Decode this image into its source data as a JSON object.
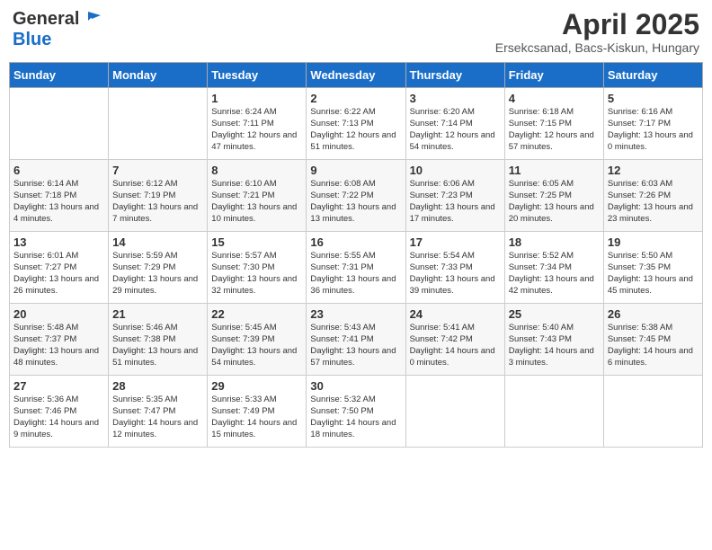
{
  "header": {
    "logo_general": "General",
    "logo_blue": "Blue",
    "title": "April 2025",
    "subtitle": "Ersekcsanad, Bacs-Kiskun, Hungary"
  },
  "days_of_week": [
    "Sunday",
    "Monday",
    "Tuesday",
    "Wednesday",
    "Thursday",
    "Friday",
    "Saturday"
  ],
  "weeks": [
    [
      {
        "day": "",
        "info": ""
      },
      {
        "day": "",
        "info": ""
      },
      {
        "day": "1",
        "info": "Sunrise: 6:24 AM\nSunset: 7:11 PM\nDaylight: 12 hours and 47 minutes."
      },
      {
        "day": "2",
        "info": "Sunrise: 6:22 AM\nSunset: 7:13 PM\nDaylight: 12 hours and 51 minutes."
      },
      {
        "day": "3",
        "info": "Sunrise: 6:20 AM\nSunset: 7:14 PM\nDaylight: 12 hours and 54 minutes."
      },
      {
        "day": "4",
        "info": "Sunrise: 6:18 AM\nSunset: 7:15 PM\nDaylight: 12 hours and 57 minutes."
      },
      {
        "day": "5",
        "info": "Sunrise: 6:16 AM\nSunset: 7:17 PM\nDaylight: 13 hours and 0 minutes."
      }
    ],
    [
      {
        "day": "6",
        "info": "Sunrise: 6:14 AM\nSunset: 7:18 PM\nDaylight: 13 hours and 4 minutes."
      },
      {
        "day": "7",
        "info": "Sunrise: 6:12 AM\nSunset: 7:19 PM\nDaylight: 13 hours and 7 minutes."
      },
      {
        "day": "8",
        "info": "Sunrise: 6:10 AM\nSunset: 7:21 PM\nDaylight: 13 hours and 10 minutes."
      },
      {
        "day": "9",
        "info": "Sunrise: 6:08 AM\nSunset: 7:22 PM\nDaylight: 13 hours and 13 minutes."
      },
      {
        "day": "10",
        "info": "Sunrise: 6:06 AM\nSunset: 7:23 PM\nDaylight: 13 hours and 17 minutes."
      },
      {
        "day": "11",
        "info": "Sunrise: 6:05 AM\nSunset: 7:25 PM\nDaylight: 13 hours and 20 minutes."
      },
      {
        "day": "12",
        "info": "Sunrise: 6:03 AM\nSunset: 7:26 PM\nDaylight: 13 hours and 23 minutes."
      }
    ],
    [
      {
        "day": "13",
        "info": "Sunrise: 6:01 AM\nSunset: 7:27 PM\nDaylight: 13 hours and 26 minutes."
      },
      {
        "day": "14",
        "info": "Sunrise: 5:59 AM\nSunset: 7:29 PM\nDaylight: 13 hours and 29 minutes."
      },
      {
        "day": "15",
        "info": "Sunrise: 5:57 AM\nSunset: 7:30 PM\nDaylight: 13 hours and 32 minutes."
      },
      {
        "day": "16",
        "info": "Sunrise: 5:55 AM\nSunset: 7:31 PM\nDaylight: 13 hours and 36 minutes."
      },
      {
        "day": "17",
        "info": "Sunrise: 5:54 AM\nSunset: 7:33 PM\nDaylight: 13 hours and 39 minutes."
      },
      {
        "day": "18",
        "info": "Sunrise: 5:52 AM\nSunset: 7:34 PM\nDaylight: 13 hours and 42 minutes."
      },
      {
        "day": "19",
        "info": "Sunrise: 5:50 AM\nSunset: 7:35 PM\nDaylight: 13 hours and 45 minutes."
      }
    ],
    [
      {
        "day": "20",
        "info": "Sunrise: 5:48 AM\nSunset: 7:37 PM\nDaylight: 13 hours and 48 minutes."
      },
      {
        "day": "21",
        "info": "Sunrise: 5:46 AM\nSunset: 7:38 PM\nDaylight: 13 hours and 51 minutes."
      },
      {
        "day": "22",
        "info": "Sunrise: 5:45 AM\nSunset: 7:39 PM\nDaylight: 13 hours and 54 minutes."
      },
      {
        "day": "23",
        "info": "Sunrise: 5:43 AM\nSunset: 7:41 PM\nDaylight: 13 hours and 57 minutes."
      },
      {
        "day": "24",
        "info": "Sunrise: 5:41 AM\nSunset: 7:42 PM\nDaylight: 14 hours and 0 minutes."
      },
      {
        "day": "25",
        "info": "Sunrise: 5:40 AM\nSunset: 7:43 PM\nDaylight: 14 hours and 3 minutes."
      },
      {
        "day": "26",
        "info": "Sunrise: 5:38 AM\nSunset: 7:45 PM\nDaylight: 14 hours and 6 minutes."
      }
    ],
    [
      {
        "day": "27",
        "info": "Sunrise: 5:36 AM\nSunset: 7:46 PM\nDaylight: 14 hours and 9 minutes."
      },
      {
        "day": "28",
        "info": "Sunrise: 5:35 AM\nSunset: 7:47 PM\nDaylight: 14 hours and 12 minutes."
      },
      {
        "day": "29",
        "info": "Sunrise: 5:33 AM\nSunset: 7:49 PM\nDaylight: 14 hours and 15 minutes."
      },
      {
        "day": "30",
        "info": "Sunrise: 5:32 AM\nSunset: 7:50 PM\nDaylight: 14 hours and 18 minutes."
      },
      {
        "day": "",
        "info": ""
      },
      {
        "day": "",
        "info": ""
      },
      {
        "day": "",
        "info": ""
      }
    ]
  ]
}
